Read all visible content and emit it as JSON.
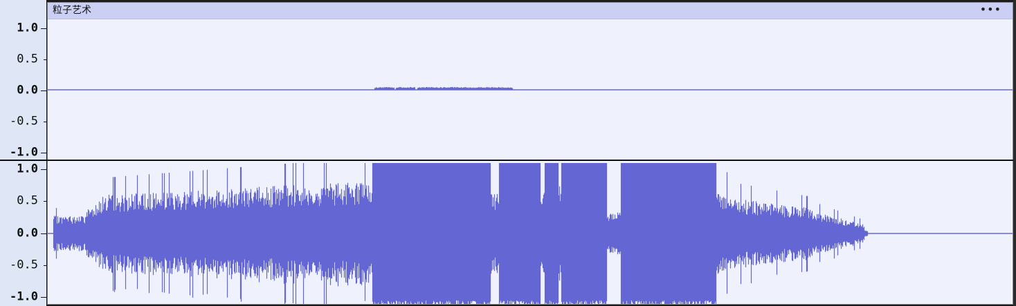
{
  "clip": {
    "title": "粒子艺术",
    "menu_label": "•••"
  },
  "ruler": {
    "ticks": [
      {
        "label": "1.0",
        "major": true
      },
      {
        "label": "0.5",
        "major": false
      },
      {
        "label": "0.0",
        "major": true
      },
      {
        "label": "-0.5",
        "major": false
      },
      {
        "label": "-1.0",
        "major": true
      }
    ]
  },
  "colors": {
    "waveform": "#6466d3",
    "background": "#eff2fd",
    "header": "#cbcff3",
    "ruler": "#dfe7f7"
  }
}
